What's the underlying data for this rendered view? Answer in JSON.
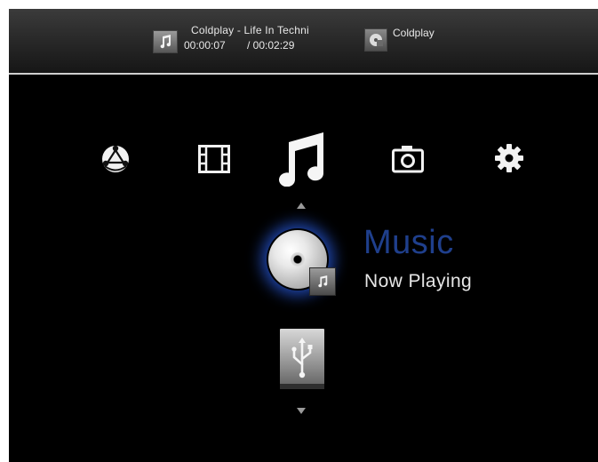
{
  "now_playing": {
    "thumb_icon": "music-note-icon",
    "title": "Coldplay - Life In Techni",
    "elapsed": "00:00:07",
    "total": "/ 00:02:29"
  },
  "artist": {
    "thumb_icon": "artist-thumbnail-icon",
    "name": "Coldplay"
  },
  "menu": {
    "icons": [
      "network-icon",
      "movie-icon",
      "music-icon",
      "photo-icon",
      "settings-icon"
    ],
    "selected": "music-icon"
  },
  "category": {
    "icon": "music-disc-icon",
    "title": "Music",
    "subtitle": "Now Playing",
    "next_icon": "usb-icon"
  },
  "colors": {
    "title_blue": "#1f3f8c",
    "glow_blue": "#285adc",
    "background": "#000000"
  }
}
